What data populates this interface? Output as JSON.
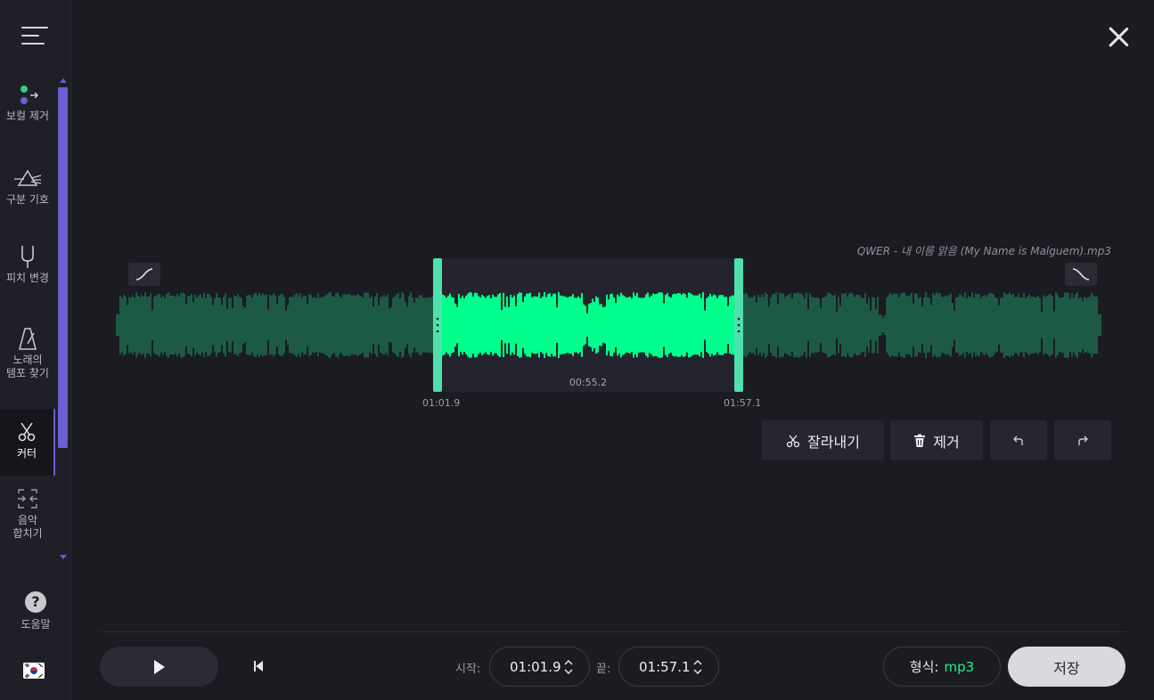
{
  "sidebar": {
    "items": [
      {
        "label": "보컬 제거",
        "icon": "vocal-remover-icon"
      },
      {
        "label": "구분 기호",
        "icon": "splitter-prism-icon"
      },
      {
        "label": "피치 변경",
        "icon": "tuning-fork-icon"
      },
      {
        "label": "노래의 템포 찾기",
        "icon": "metronome-icon"
      },
      {
        "label": "커터",
        "icon": "scissors-icon",
        "active": true
      },
      {
        "label": "음악 합치기",
        "icon": "joiner-icon"
      }
    ],
    "help_label": "도움말",
    "help_icon": "?",
    "language_flag": "korea-flag-icon",
    "accent_color": "#6b5fd3"
  },
  "editor": {
    "file_name": "QWER - 내 이름 맑음 (My Name is Malguem).mp3",
    "selection": {
      "start_label": "01:01.9",
      "end_label": "01:57.1",
      "duration_label": "00:55.2"
    },
    "waveform_colors": {
      "selected": "#00ff8c",
      "unselected": "#1c5a45",
      "handle": "#4fe0ad"
    }
  },
  "actions": {
    "cut_label": "잘라내기",
    "remove_label": "제거"
  },
  "bottom": {
    "start_label": "시작:",
    "start_value": "01:01.9",
    "end_label": "끝:",
    "end_value": "01:57.1",
    "format_label": "형식:",
    "format_value": "mp3",
    "save_label": "저장"
  }
}
